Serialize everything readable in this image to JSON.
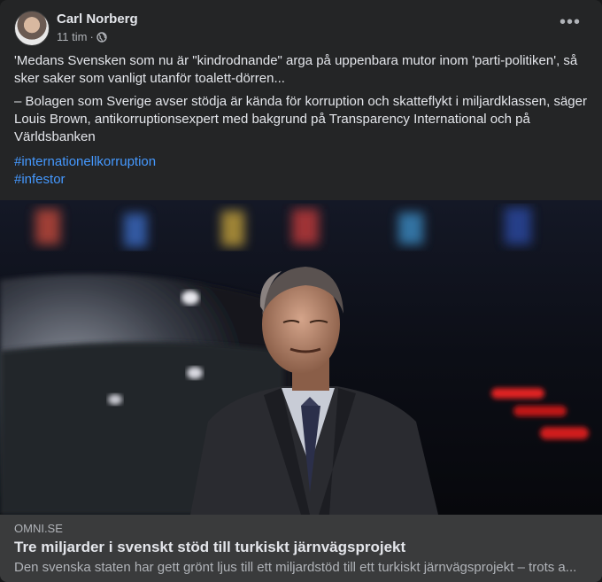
{
  "post": {
    "author": "Carl Norberg",
    "time": "11 tim",
    "separator": "·",
    "privacy_icon": "globe-icon",
    "more_icon": "more-options-icon",
    "more_label": "•••",
    "paragraphs": [
      "'Medans Svensken som nu är \"kindrodnande\" arga på uppenbara mutor inom 'parti-politiken', så sker saker som vanligt utanför toalett-dörren...",
      "– Bolagen som Sverige avser stödja är kända för korruption och skatteflykt i miljardklassen, säger Louis Brown, antikorruptionsexpert med bakgrund på Transparency International och på Världsbanken"
    ],
    "hashtags": [
      "#internationellkorruption",
      "#infestor"
    ]
  },
  "link_preview": {
    "domain": "OMNI.SE",
    "title": "Tre miljarder i svenskt stöd till turkiskt järnvägsprojekt",
    "description": "Den svenska staten har gett grönt ljus till ett miljardstöd till ett turkiskt järnvägsprojekt – trots a..."
  },
  "colors": {
    "card_bg": "#242526",
    "text": "#e4e6eb",
    "secondary_text": "#b0b3b8",
    "link": "#4599ff",
    "preview_bg": "#3a3b3c"
  }
}
